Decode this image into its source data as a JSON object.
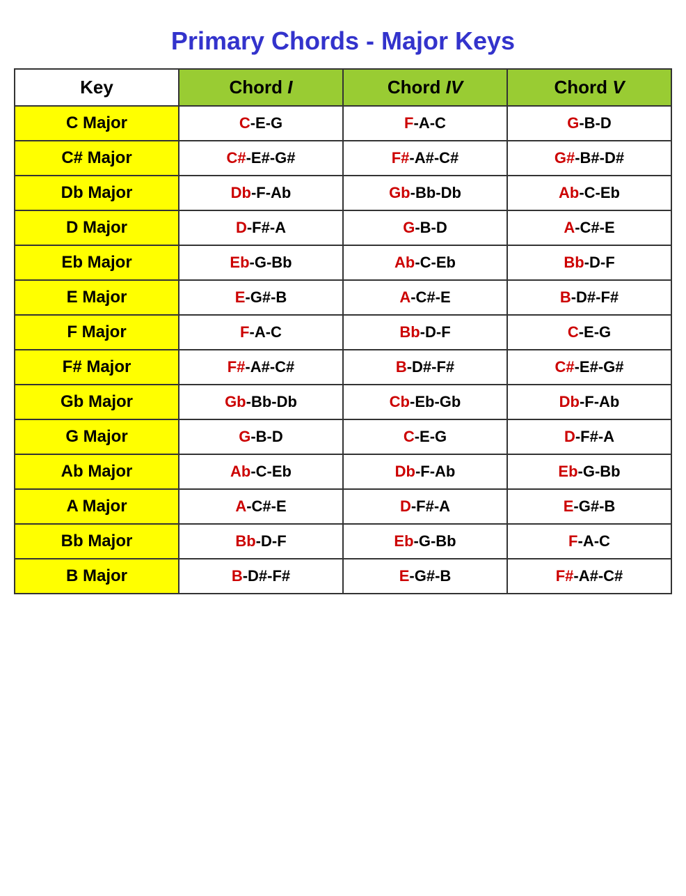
{
  "title": "Primary Chords - Major Keys",
  "headers": {
    "key": "Key",
    "chord1": "Chord",
    "chord1_roman": "I",
    "chord4": "Chord",
    "chord4_roman": "IV",
    "chord5": "Chord",
    "chord5_roman": "V"
  },
  "rows": [
    {
      "key": "C Major",
      "chord1_root": "C",
      "chord1_rest": "-E-G",
      "chord4_root": "F",
      "chord4_rest": "-A-C",
      "chord5_root": "G",
      "chord5_rest": "-B-D"
    },
    {
      "key": "C# Major",
      "chord1_root": "C#",
      "chord1_rest": "-E#-G#",
      "chord4_root": "F#",
      "chord4_rest": "-A#-C#",
      "chord5_root": "G#",
      "chord5_rest": "-B#-D#"
    },
    {
      "key": "Db Major",
      "chord1_root": "Db",
      "chord1_rest": "-F-Ab",
      "chord4_root": "Gb",
      "chord4_rest": "-Bb-Db",
      "chord5_root": "Ab",
      "chord5_rest": "-C-Eb"
    },
    {
      "key": "D Major",
      "chord1_root": "D",
      "chord1_rest": "-F#-A",
      "chord4_root": "G",
      "chord4_rest": "-B-D",
      "chord5_root": "A",
      "chord5_rest": "-C#-E"
    },
    {
      "key": "Eb Major",
      "chord1_root": "Eb",
      "chord1_rest": "-G-Bb",
      "chord4_root": "Ab",
      "chord4_rest": "-C-Eb",
      "chord5_root": "Bb",
      "chord5_rest": "-D-F"
    },
    {
      "key": "E Major",
      "chord1_root": "E",
      "chord1_rest": "-G#-B",
      "chord4_root": "A",
      "chord4_rest": "-C#-E",
      "chord5_root": "B",
      "chord5_rest": "-D#-F#"
    },
    {
      "key": "F Major",
      "chord1_root": "F",
      "chord1_rest": "-A-C",
      "chord4_root": "Bb",
      "chord4_rest": "-D-F",
      "chord5_root": "C",
      "chord5_rest": "-E-G"
    },
    {
      "key": "F# Major",
      "chord1_root": "F#",
      "chord1_rest": "-A#-C#",
      "chord4_root": "B",
      "chord4_rest": "-D#-F#",
      "chord5_root": "C#",
      "chord5_rest": "-E#-G#"
    },
    {
      "key": "Gb Major",
      "chord1_root": "Gb",
      "chord1_rest": "-Bb-Db",
      "chord4_root": "Cb",
      "chord4_rest": "-Eb-Gb",
      "chord5_root": "Db",
      "chord5_rest": "-F-Ab"
    },
    {
      "key": "G Major",
      "chord1_root": "G",
      "chord1_rest": "-B-D",
      "chord4_root": "C",
      "chord4_rest": "-E-G",
      "chord5_root": "D",
      "chord5_rest": "-F#-A"
    },
    {
      "key": "Ab Major",
      "chord1_root": "Ab",
      "chord1_rest": "-C-Eb",
      "chord4_root": "Db",
      "chord4_rest": "-F-Ab",
      "chord5_root": "Eb",
      "chord5_rest": "-G-Bb"
    },
    {
      "key": "A Major",
      "chord1_root": "A",
      "chord1_rest": "-C#-E",
      "chord4_root": "D",
      "chord4_rest": "-F#-A",
      "chord5_root": "E",
      "chord5_rest": "-G#-B"
    },
    {
      "key": "Bb Major",
      "chord1_root": "Bb",
      "chord1_rest": "-D-F",
      "chord4_root": "Eb",
      "chord4_rest": "-G-Bb",
      "chord5_root": "F",
      "chord5_rest": "-A-C"
    },
    {
      "key": "B Major",
      "chord1_root": "B",
      "chord1_rest": "-D#-F#",
      "chord4_root": "E",
      "chord4_rest": "-G#-B",
      "chord5_root": "F#",
      "chord5_rest": "-A#-C#"
    }
  ]
}
